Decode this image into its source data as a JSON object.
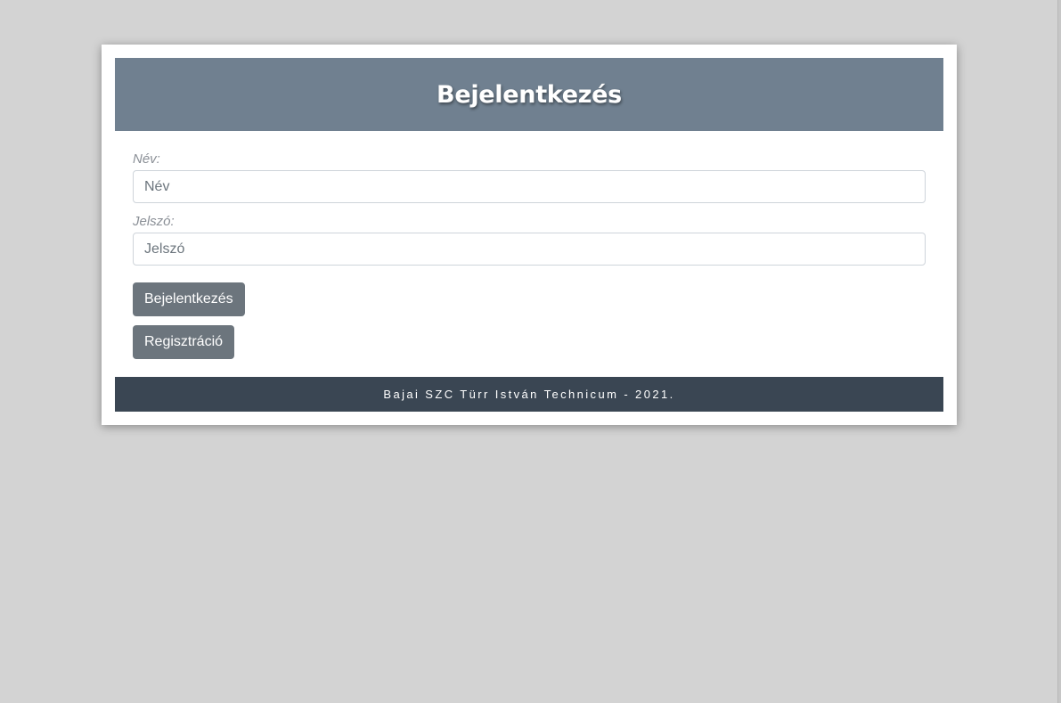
{
  "header": {
    "title": "Bejelentkezés"
  },
  "form": {
    "name_label": "Név:",
    "name_placeholder": "Név",
    "password_label": "Jelszó:",
    "password_placeholder": "Jelszó",
    "login_button": "Bejelentkezés",
    "register_button": "Regisztráció"
  },
  "footer": {
    "text": "Bajai SZC Türr István Technicum - 2021."
  },
  "colors": {
    "page_background": "#d3d3d3",
    "header_background": "#708090",
    "button_background": "#6c757d",
    "footer_background": "#3a4653"
  }
}
